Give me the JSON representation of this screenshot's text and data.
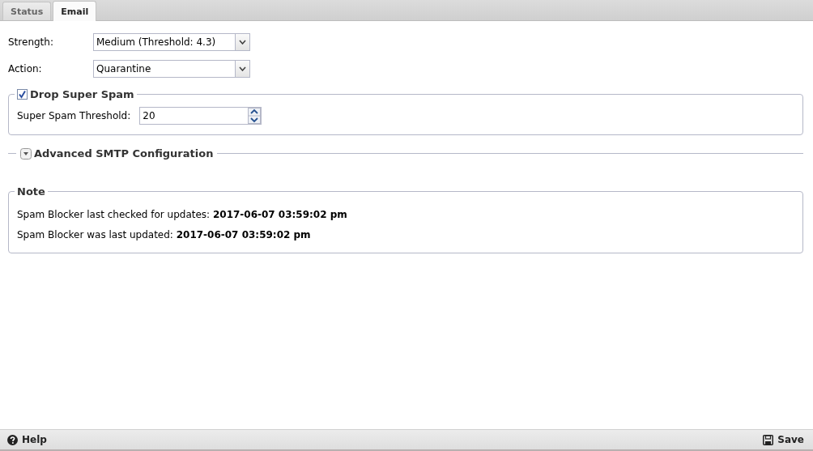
{
  "tabs": [
    {
      "label": "Status",
      "selected": false
    },
    {
      "label": "Email",
      "selected": true
    }
  ],
  "fields": [
    {
      "label": "Strength:",
      "value": "Medium (Threshold: 4.3)",
      "kind": "select"
    },
    {
      "label": "Action:",
      "value": "Quarantine",
      "kind": "select"
    }
  ],
  "super_spam": {
    "title": "Drop Super Spam",
    "checked": true,
    "fields": [
      {
        "label": "Super Spam Threshold:",
        "value": "20",
        "kind": "spinner"
      }
    ]
  },
  "advanced": {
    "title": "Advanced SMTP Configuration",
    "expanded": false
  },
  "note": {
    "title": "Note",
    "lines": [
      "Spam Blocker last checked for updates: **2017-06-07 03:59:02 pm**",
      "Spam Blocker was last updated: **2017-06-07 03:59:02 pm**"
    ]
  },
  "toolbar": {
    "help": "Help",
    "save": "Save"
  }
}
